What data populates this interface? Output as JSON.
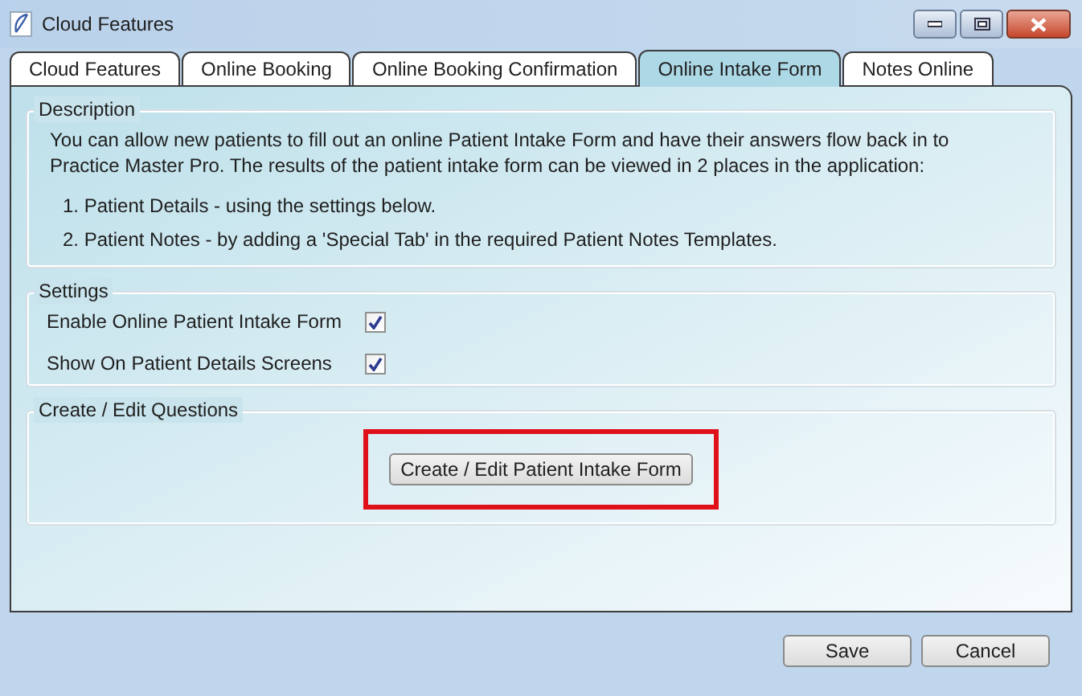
{
  "window": {
    "title": "Cloud Features"
  },
  "tabs": [
    {
      "label": "Cloud Features",
      "selected": false
    },
    {
      "label": "Online Booking",
      "selected": false
    },
    {
      "label": "Online Booking Confirmation",
      "selected": false
    },
    {
      "label": "Online Intake Form",
      "selected": true
    },
    {
      "label": "Notes Online",
      "selected": false
    }
  ],
  "description": {
    "title": "Description",
    "text": "You can allow new patients to fill out an online Patient Intake Form and have their answers flow back in to Practice Master Pro. The results of the patient intake form can be viewed in 2 places in the application:",
    "items": [
      "1. Patient Details - using the settings below.",
      "2. Patient Notes - by adding a 'Special Tab' in the required Patient Notes Templates."
    ]
  },
  "settings": {
    "title": "Settings",
    "options": [
      {
        "label": "Enable Online Patient Intake Form",
        "checked": true
      },
      {
        "label": "Show On Patient Details Screens",
        "checked": true
      }
    ]
  },
  "questions": {
    "title": "Create / Edit Questions",
    "button": "Create / Edit Patient Intake Form"
  },
  "buttons": [
    "Save",
    "Cancel"
  ]
}
